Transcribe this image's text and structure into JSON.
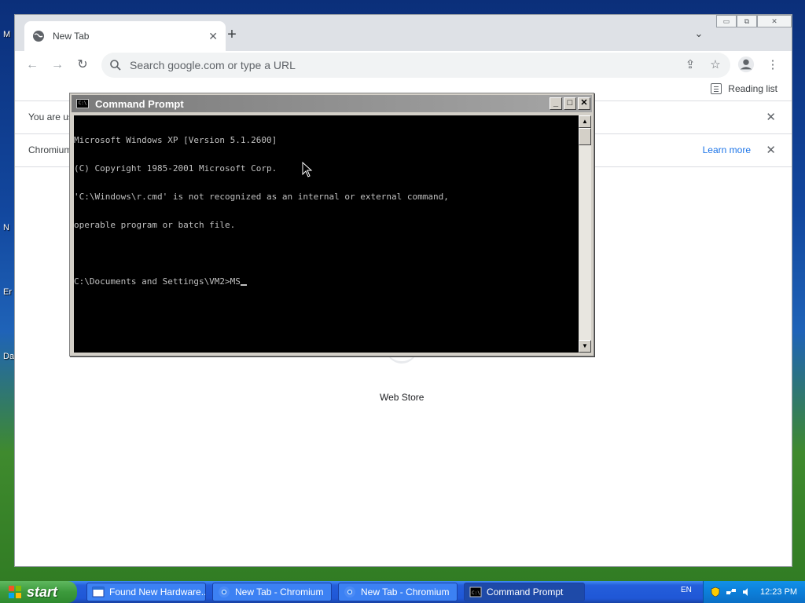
{
  "desktop": {
    "icon_labels": [
      "M",
      "N",
      "Er",
      "Da"
    ]
  },
  "browser": {
    "tab": {
      "title": "New Tab"
    },
    "omnibox": {
      "placeholder": "Search google.com or type a URL"
    },
    "bookmarks": {
      "reading_list": "Reading list"
    },
    "infobars": [
      {
        "text": "You are us",
        "learn_more": ""
      },
      {
        "text": "Chromium",
        "learn_more": "Learn more"
      }
    ],
    "page": {
      "webstore_label": "Web Store"
    }
  },
  "cmd": {
    "title": "Command Prompt",
    "lines": [
      "Microsoft Windows XP [Version 5.1.2600]",
      "(C) Copyright 1985-2001 Microsoft Corp.",
      "'C:\\Windows\\r.cmd' is not recognized as an internal or external command,",
      "operable program or batch file.",
      "",
      "C:\\Documents and Settings\\VM2>MS"
    ]
  },
  "taskbar": {
    "start_label": "start",
    "items": [
      {
        "label": "Found New Hardware..."
      },
      {
        "label": "New Tab - Chromium"
      },
      {
        "label": "New Tab - Chromium"
      },
      {
        "label": "Command Prompt"
      }
    ],
    "language": "EN",
    "clock": "12:23 PM"
  }
}
